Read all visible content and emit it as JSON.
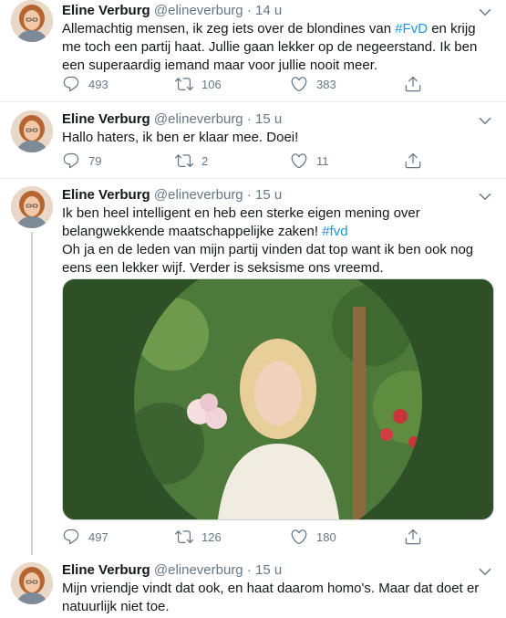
{
  "tweets": [
    {
      "name": "Eline Verburg",
      "handle": "@elineverburg",
      "dot": "·",
      "time": "14 u",
      "text_parts": [
        "Allemachtig mensen, ik zeg iets over de blondines van ",
        "#FvD",
        " en krijg me toch een partij haat. Jullie gaan lekker op de negeerstand. Ik ben een superaardig iemand maar voor jullie nooit meer."
      ],
      "replies": "493",
      "retweets": "106",
      "likes": "383"
    },
    {
      "name": "Eline Verburg",
      "handle": "@elineverburg",
      "dot": "·",
      "time": "15 u",
      "text": "Hallo haters, ik ben er klaar mee. Doei!",
      "replies": "79",
      "retweets": "2",
      "likes": "11"
    },
    {
      "name": "Eline Verburg",
      "handle": "@elineverburg",
      "dot": "·",
      "time": "15 u",
      "text_parts": [
        "Ik ben heel intelligent en heb een sterke eigen mening over belangwekkende maatschappelijke zaken! ",
        "#fvd"
      ],
      "text2": "Oh ja en de leden van mijn partij vinden dat top want ik ben ook nog eens een lekker wijf. Verder is seksisme ons vreemd.",
      "replies": "497",
      "retweets": "126",
      "likes": "180"
    },
    {
      "name": "Eline Verburg",
      "handle": "@elineverburg",
      "dot": "·",
      "time": "15 u",
      "text": "Mijn vriendje vindt dat ook, en haat daarom homo's. Maar dat doet er natuurlijk niet toe."
    }
  ],
  "icons": {
    "reply": "reply-icon",
    "retweet": "retweet-icon",
    "like": "heart-icon",
    "share": "share-icon",
    "caret": "chevron-down-icon"
  },
  "colors": {
    "link": "#1b95e0",
    "muted": "#657786",
    "media_bg": "#2e5027"
  }
}
